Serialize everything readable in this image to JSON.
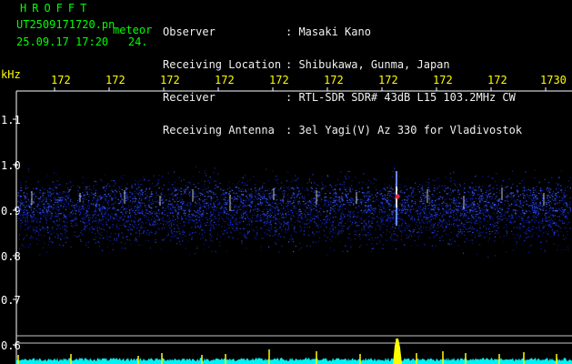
{
  "app": {
    "title": "HROFFT"
  },
  "record": {
    "file_name": "UT2509171720.pn",
    "file_type": "meteor",
    "date_time": "25.09.17 17:20",
    "value": "24."
  },
  "station": {
    "fields": [
      {
        "label": "Observer",
        "value": ": Masaki Kano"
      },
      {
        "label": "Receiving Location",
        "value": ": Shibukawa, Gunma, Japan"
      },
      {
        "label": "Receiver",
        "value": ": RTL-SDR SDR# 43dB L15 103.2MHz CW"
      },
      {
        "label": "Receiving Antenna",
        "value": ": 3el Yagi(V) Az 330 for Vladivostok"
      }
    ]
  },
  "axes": {
    "y_unit": "kHz",
    "y_ticks": [
      "1.1",
      "1.0",
      "0.9",
      "0.8",
      "0.7",
      "0.6"
    ],
    "x_ticks": [
      "172",
      "172",
      "172",
      "172",
      "172",
      "172",
      "172",
      "172",
      "172",
      "1730"
    ]
  },
  "colors": {
    "background": "#000000",
    "header_green": "#00ff00",
    "tick_yellow": "#ffff00",
    "noise_blue": "#1a33ff",
    "signal_red": "#ff2020",
    "spectrum_cyan": "#00ffff",
    "spike_yellow": "#ffff00"
  }
}
